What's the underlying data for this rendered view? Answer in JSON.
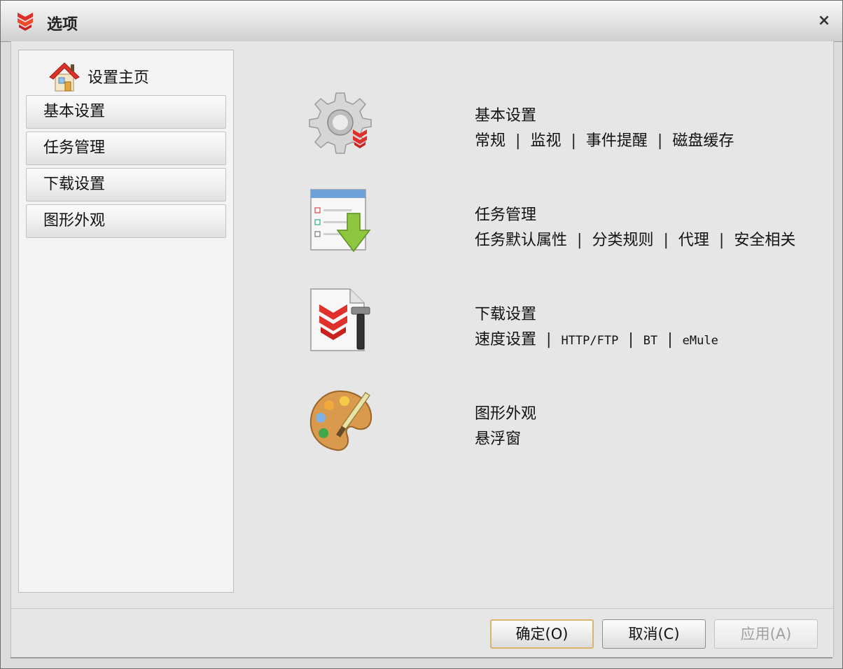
{
  "window": {
    "title": "选项",
    "close_glyph": "×"
  },
  "sidebar": {
    "home_label": "设置主页",
    "items": [
      {
        "label": "基本设置"
      },
      {
        "label": "任务管理"
      },
      {
        "label": "下载设置"
      },
      {
        "label": "图形外观"
      }
    ]
  },
  "sections": [
    {
      "title": "基本设置",
      "icon": "gear-icon",
      "links": [
        "常规",
        "监视",
        "事件提醒",
        "磁盘缓存"
      ]
    },
    {
      "title": "任务管理",
      "icon": "task-list-download-icon",
      "links": [
        "任务默认属性",
        "分类规则",
        "代理",
        "安全相关"
      ]
    },
    {
      "title": "下载设置",
      "icon": "download-tool-icon",
      "links": [
        "速度设置",
        "HTTP/FTP",
        "BT",
        "eMule"
      ]
    },
    {
      "title": "图形外观",
      "icon": "palette-icon",
      "links": [
        "悬浮窗"
      ]
    }
  ],
  "separator": "|",
  "buttons": {
    "ok": "确定(O)",
    "cancel": "取消(C)",
    "apply": "应用(A)"
  },
  "colors": {
    "accent_red": "#e0302a",
    "button_focus": "#d8b56a"
  }
}
